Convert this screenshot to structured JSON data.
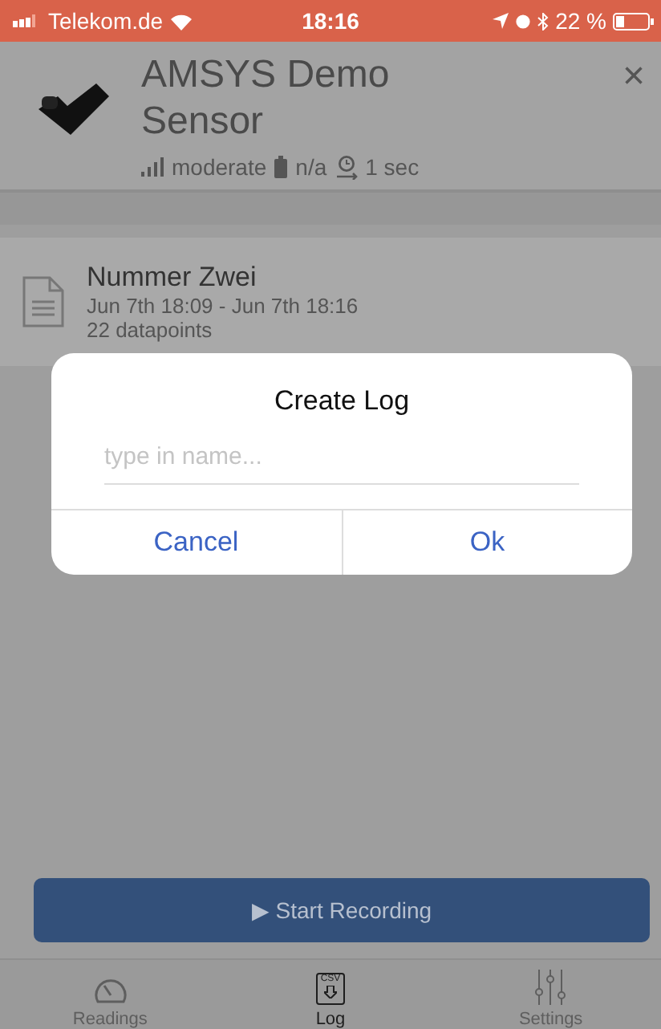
{
  "status_bar": {
    "carrier": "Telekom.de",
    "time": "18:16",
    "battery": "22 %"
  },
  "header": {
    "title": "AMSYS Demo Sensor",
    "signal": "moderate",
    "battery": "n/a",
    "interval": "1 sec",
    "close": "×"
  },
  "logs": [
    {
      "name": "Nummer Zwei",
      "range": "Jun 7th 18:09 - Jun 7th 18:16",
      "count": "22 datapoints"
    }
  ],
  "dialog": {
    "title": "Create Log",
    "placeholder": "type in name...",
    "buttons": [
      "Cancel",
      "Ok"
    ]
  },
  "record_button": {
    "icon": "▶",
    "label": "Start Recording"
  },
  "tabs": [
    {
      "kind": "readings",
      "label": "Readings",
      "selected": false
    },
    {
      "kind": "log",
      "label": "Log",
      "selected": true,
      "icon_text": "CSV"
    },
    {
      "kind": "settings",
      "label": "Settings",
      "selected": false
    }
  ]
}
